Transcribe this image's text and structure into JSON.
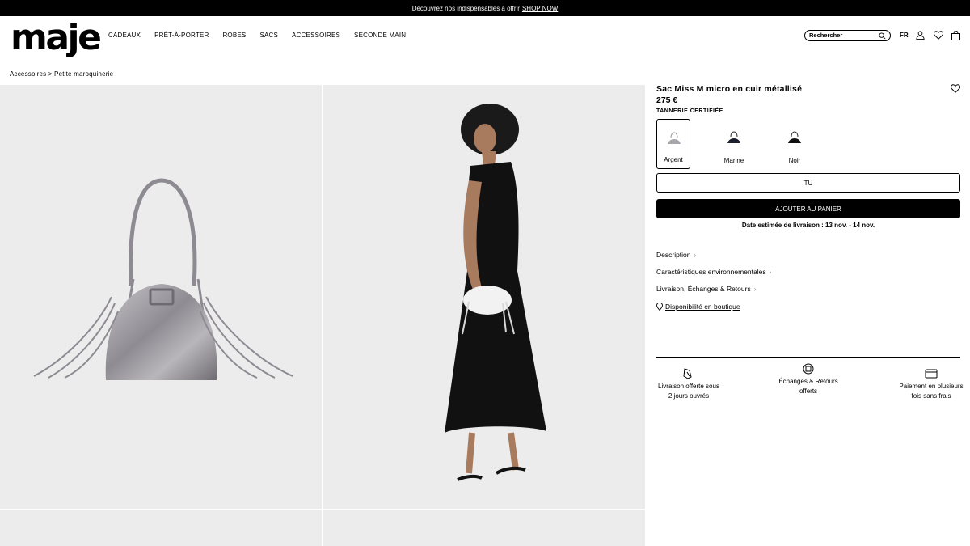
{
  "promo": {
    "text": "Découvrez nos indispensables à offrir",
    "link": "SHOP NOW"
  },
  "header": {
    "logo": "maje",
    "nav": [
      "CADEAUX",
      "PRÊT-À-PORTER",
      "ROBES",
      "SACS",
      "ACCESSOIRES",
      "SECONDE MAIN"
    ],
    "search_placeholder": "Rechercher",
    "lang": "FR",
    "icons": [
      "search-icon",
      "user-icon",
      "heart-icon",
      "bag-icon"
    ]
  },
  "breadcrumb": "Accessoires > Petite maroquinerie",
  "product": {
    "title": "Sac Miss M micro en cuir métallisé",
    "price": "275 €",
    "badge": "TANNERIE CERTIFIÉE",
    "colors": [
      {
        "label": "Argent",
        "hex": "#a9a6ab",
        "selected": true
      },
      {
        "label": "Marine",
        "hex": "#1b1f2e",
        "selected": false
      },
      {
        "label": "Noir",
        "hex": "#111111",
        "selected": false
      }
    ],
    "size": "TU",
    "add_to_cart": "AJOUTER AU PANIER",
    "delivery": "Date estimée de livraison : 13 nov. - 14 nov.",
    "accordions": [
      "Description",
      "Caractéristiques environnementales",
      "Livraison, Échanges & Retours"
    ],
    "availability": "Disponibilité en boutique",
    "perks": [
      {
        "icon": "delivery-icon",
        "text": "Livraison offerte sous 2 jours ouvrés"
      },
      {
        "icon": "return-icon",
        "text": "Échanges & Retours offerts"
      },
      {
        "icon": "card-icon",
        "text": "Paiement en plusieurs fois sans frais"
      }
    ]
  },
  "colors": {
    "page_bg": "#ffffff",
    "image_bg": "#ececec",
    "accent": "#000000"
  }
}
